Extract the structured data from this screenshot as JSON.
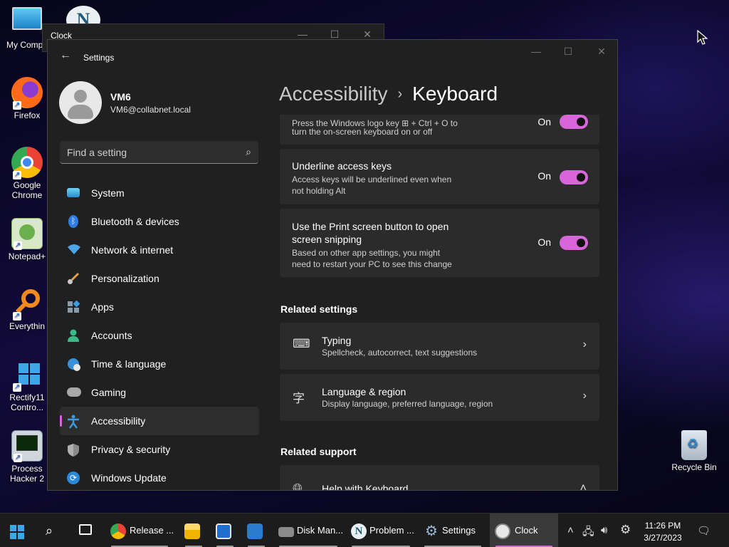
{
  "desktop_icons": [
    {
      "label": "My Compu",
      "kind": "computer"
    },
    {
      "label": "Firefox",
      "kind": "firefox"
    },
    {
      "label": "Google Chrome",
      "kind": "chrome"
    },
    {
      "label": "Notepad+",
      "kind": "notepad"
    },
    {
      "label": "Everythin",
      "kind": "everything"
    },
    {
      "label": "Rectify11 Contro...",
      "kind": "rectify"
    },
    {
      "label": "Process Hacker 2",
      "kind": "processhacker"
    },
    {
      "label": "Recycle Bin",
      "kind": "recyclebin"
    }
  ],
  "clock_window": {
    "title": "Clock"
  },
  "settings": {
    "title": "Settings",
    "user": {
      "name": "VM6",
      "email": "VM6@collabnet.local"
    },
    "search_placeholder": "Find a setting",
    "nav": [
      {
        "label": "System",
        "icon": "monitor-icon",
        "color": "#3aa0d8"
      },
      {
        "label": "Bluetooth & devices",
        "icon": "bluetooth-icon",
        "color": "#2f7de1"
      },
      {
        "label": "Network & internet",
        "icon": "wifi-icon",
        "color": "#4aa6e6"
      },
      {
        "label": "Personalization",
        "icon": "brush-icon",
        "color": "#e5a04d"
      },
      {
        "label": "Apps",
        "icon": "apps-icon",
        "color": "#8a9aab"
      },
      {
        "label": "Accounts",
        "icon": "person-icon",
        "color": "#3cb889"
      },
      {
        "label": "Time & language",
        "icon": "globe-clock-icon",
        "color": "#3b8fd6"
      },
      {
        "label": "Gaming",
        "icon": "gamepad-icon",
        "color": "#9a9a9a"
      },
      {
        "label": "Accessibility",
        "icon": "accessibility-icon",
        "color": "#3a9be0"
      },
      {
        "label": "Privacy & security",
        "icon": "shield-icon",
        "color": "#7a7a7a"
      },
      {
        "label": "Windows Update",
        "icon": "update-icon",
        "color": "#2b88d8"
      }
    ],
    "active_nav": "Accessibility",
    "breadcrumb": {
      "parent": "Accessibility",
      "separator": "›",
      "current": "Keyboard"
    },
    "cards": [
      {
        "desc1": "Press the Windows logo key ⊞ + Ctrl + O to",
        "desc2": "turn the on-screen keyboard on or off",
        "state": "On"
      },
      {
        "title": "Underline access keys",
        "desc1": "Access keys will be underlined even when",
        "desc2": "not holding Alt",
        "state": "On"
      },
      {
        "title1": "Use the Print screen button to open",
        "title2": "screen snipping",
        "desc1": "Based on other app settings, you might",
        "desc2": "need to restart your PC to see this change",
        "state": "On"
      }
    ],
    "related_settings_heading": "Related settings",
    "related": [
      {
        "title": "Typing",
        "desc": "Spellcheck, autocorrect, text suggestions"
      },
      {
        "title": "Language & region",
        "desc": "Display language, preferred language, region"
      }
    ],
    "related_support_heading": "Related support",
    "support": [
      {
        "title": "Help with Keyboard"
      }
    ]
  },
  "taskbar": {
    "apps": [
      {
        "label": "Release ...",
        "icon": "chrome-icon"
      },
      {
        "label": "",
        "icon": "explorer-icon"
      },
      {
        "label": "",
        "icon": "app-icon"
      },
      {
        "label": "",
        "icon": "app2-icon"
      },
      {
        "label": "Disk Man...",
        "icon": "disk-icon"
      },
      {
        "label": "Problem ...",
        "icon": "nc-icon"
      },
      {
        "label": "Settings",
        "icon": "settings-icon"
      },
      {
        "label": "Clock",
        "icon": "clock-icon"
      }
    ],
    "time": "11:26 PM",
    "date": "3/27/2023"
  },
  "colors": {
    "accent": "#d865d9",
    "window_bg": "#202020",
    "card_bg": "#2b2b2b"
  }
}
